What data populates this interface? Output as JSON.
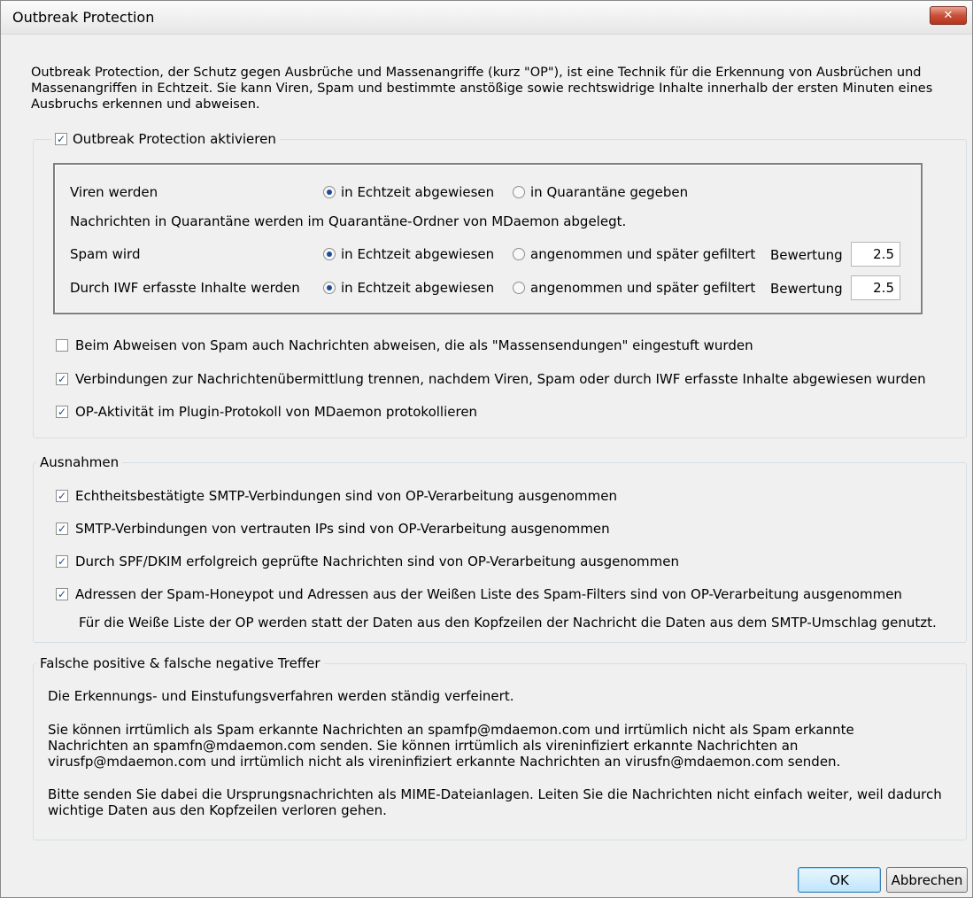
{
  "window": {
    "title": "Outbreak Protection",
    "close_label": "✕"
  },
  "intro": "Outbreak Protection, der Schutz gegen Ausbrüche und Massenangriffe (kurz \"OP\"), ist eine Technik für die Erkennung von Ausbrüchen und Massenangriffen in Echtzeit. Sie kann Viren, Spam und bestimmte anstößige sowie rechtswidrige Inhalte innerhalb der ersten Minuten eines Ausbruchs erkennen und abweisen.",
  "activate": {
    "label": "Outbreak Protection aktivieren",
    "checked": true
  },
  "settings": {
    "viruses": {
      "label": "Viren werden",
      "option1": "in Echtzeit abgewiesen",
      "option2": "in Quarantäne gegeben",
      "selected": "option1"
    },
    "quarantine_note": "Nachrichten in Quarantäne werden im Quarantäne-Ordner von MDaemon abgelegt.",
    "spam": {
      "label": "Spam wird",
      "option1": "in Echtzeit abgewiesen",
      "option2": "angenommen und später gefiltert",
      "score_label": "Bewertung",
      "score": "2.5",
      "selected": "option1"
    },
    "iwf": {
      "label": "Durch IWF erfasste Inhalte werden",
      "option1": "in Echtzeit abgewiesen",
      "option2": "angenommen und später gefiltert",
      "score_label": "Bewertung",
      "score": "2.5",
      "selected": "option1"
    }
  },
  "options": [
    {
      "label": "Beim Abweisen von Spam auch Nachrichten abweisen, die als \"Massensendungen\" eingestuft wurden",
      "checked": false
    },
    {
      "label": "Verbindungen zur Nachrichtenübermittlung trennen, nachdem Viren, Spam oder durch IWF erfasste Inhalte abgewiesen wurden",
      "checked": true
    },
    {
      "label": "OP-Aktivität im Plugin-Protokoll von MDaemon protokollieren",
      "checked": true
    }
  ],
  "exceptions": {
    "title": "Ausnahmen",
    "items": [
      {
        "label": "Echtheitsbestätigte SMTP-Verbindungen sind von OP-Verarbeitung ausgenommen",
        "checked": true
      },
      {
        "label": "SMTP-Verbindungen von vertrauten IPs sind von OP-Verarbeitung ausgenommen",
        "checked": true
      },
      {
        "label": "Durch SPF/DKIM erfolgreich geprüfte Nachrichten sind von OP-Verarbeitung ausgenommen",
        "checked": true
      },
      {
        "label": "Adressen der Spam-Honeypot und Adressen aus der Weißen Liste des Spam-Filters sind von OP-Verarbeitung ausgenommen",
        "checked": true
      }
    ],
    "note": "Für die Weiße Liste der OP werden statt der Daten aus den Kopfzeilen der Nachricht die Daten aus dem SMTP-Umschlag genutzt."
  },
  "false_positives": {
    "title": "Falsche positive & falsche negative Treffer",
    "p1": "Die Erkennungs- und Einstufungsverfahren werden ständig verfeinert.",
    "p2": "Sie können irrtümlich als Spam erkannte Nachrichten an spamfp@mdaemon.com und irrtümlich nicht als Spam erkannte Nachrichten an spamfn@mdaemon.com senden. Sie können irrtümlich als vireninfiziert erkannte Nachrichten an virusfp@mdaemon.com und irrtümlich nicht als vireninfiziert erkannte Nachrichten an virusfn@mdaemon.com senden.",
    "p3": "Bitte senden Sie dabei die Ursprungsnachrichten als MIME-Dateianlagen. Leiten Sie die Nachrichten nicht einfach weiter, weil dadurch wichtige Daten aus den Kopfzeilen verloren gehen."
  },
  "buttons": {
    "ok": "OK",
    "cancel": "Abbrechen"
  }
}
